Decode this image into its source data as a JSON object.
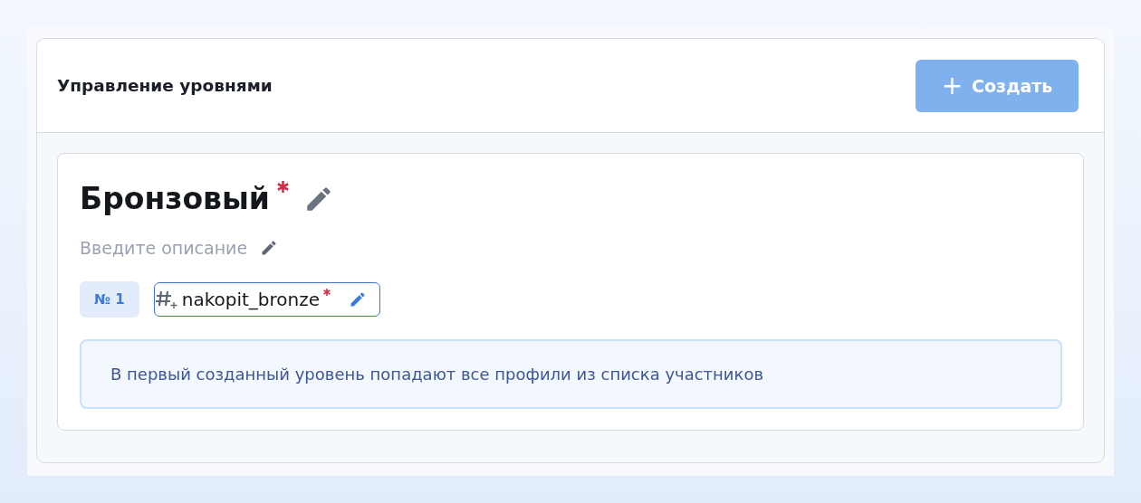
{
  "header": {
    "title": "Управление уровнями",
    "create_button": {
      "icon": "+",
      "label": "Создать",
      "disabled": true
    }
  },
  "level": {
    "name": "Бронзовый",
    "name_required": true,
    "description": {
      "placeholder": "Введите описание"
    },
    "number": "№ 1",
    "code": {
      "value": "nakopit_bronze",
      "required": true,
      "focused": true
    },
    "info": "В первый созданный уровень попадают все профили из списка участников"
  }
}
